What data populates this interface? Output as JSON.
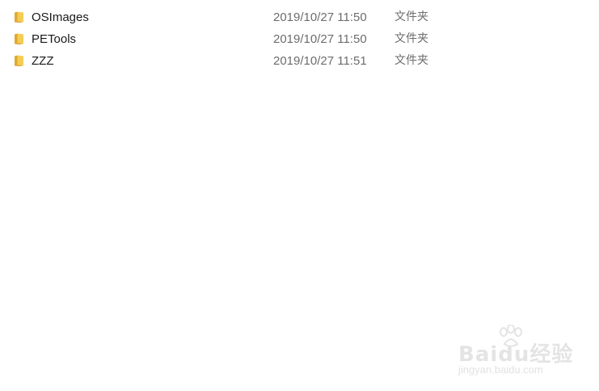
{
  "files": [
    {
      "name": "OSImages",
      "date": "2019/10/27 11:50",
      "type": "文件夹",
      "icon": "folder-icon"
    },
    {
      "name": "PETools",
      "date": "2019/10/27 11:50",
      "type": "文件夹",
      "icon": "folder-icon"
    },
    {
      "name": "ZZZ",
      "date": "2019/10/27 11:51",
      "type": "文件夹",
      "icon": "folder-icon"
    }
  ],
  "watermark": {
    "logo": "Baidu经验",
    "url": "jingyan.baidu.com"
  },
  "colors": {
    "folder_yellow": "#f2c94c",
    "folder_dark": "#e0a82e",
    "text_primary": "#1a1a1a",
    "text_secondary": "#6d6d6d"
  }
}
